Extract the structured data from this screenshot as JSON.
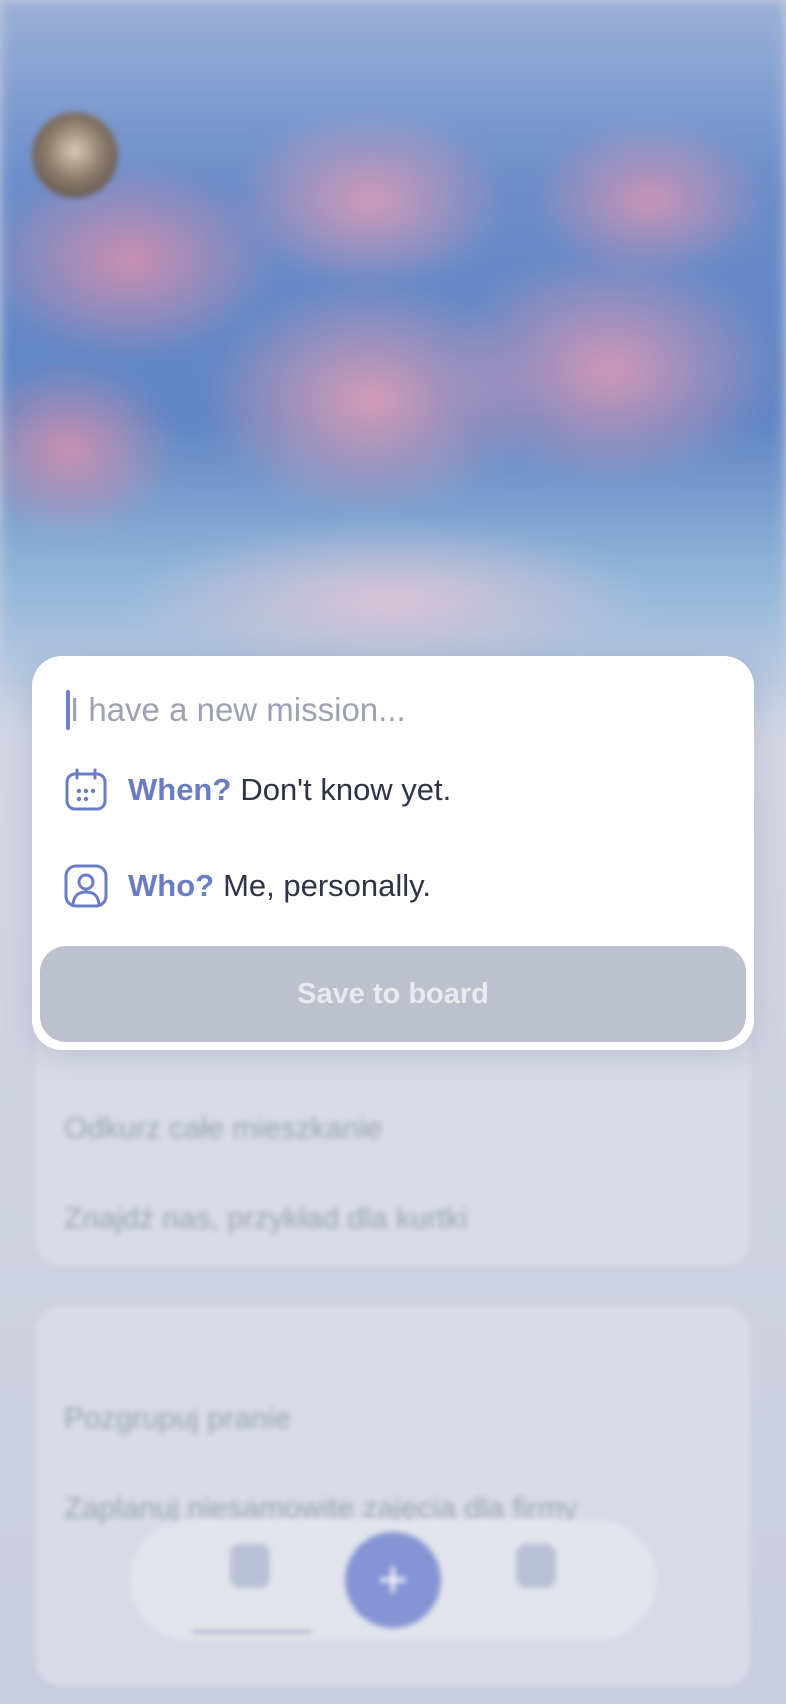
{
  "new_mission": {
    "input": {
      "placeholder": "I have a new mission...",
      "value": ""
    },
    "when": {
      "icon": "calendar-icon",
      "label": "When?",
      "value": "Don't know yet."
    },
    "who": {
      "icon": "user-icon",
      "label": "Who?",
      "value": "Me, personally."
    },
    "save_label": "Save to board"
  },
  "background": {
    "cards": [
      {
        "section": "",
        "items": [
          "Odkurz całe mieszkanie",
          "Znajdź nas, przykład dla kurtki"
        ]
      },
      {
        "section": "",
        "items": [
          "Pozgrupuj pranie",
          "Zaplanuj niesamowite zajęcia dla firmy"
        ]
      }
    ],
    "nav": {
      "left_label": "",
      "right_label": "",
      "add_icon": "plus-icon"
    }
  },
  "colors": {
    "accent": "#6a7cc6",
    "text": "#2e3347",
    "placeholder": "#9da1b2",
    "button_disabled": "#bdc0cd"
  }
}
